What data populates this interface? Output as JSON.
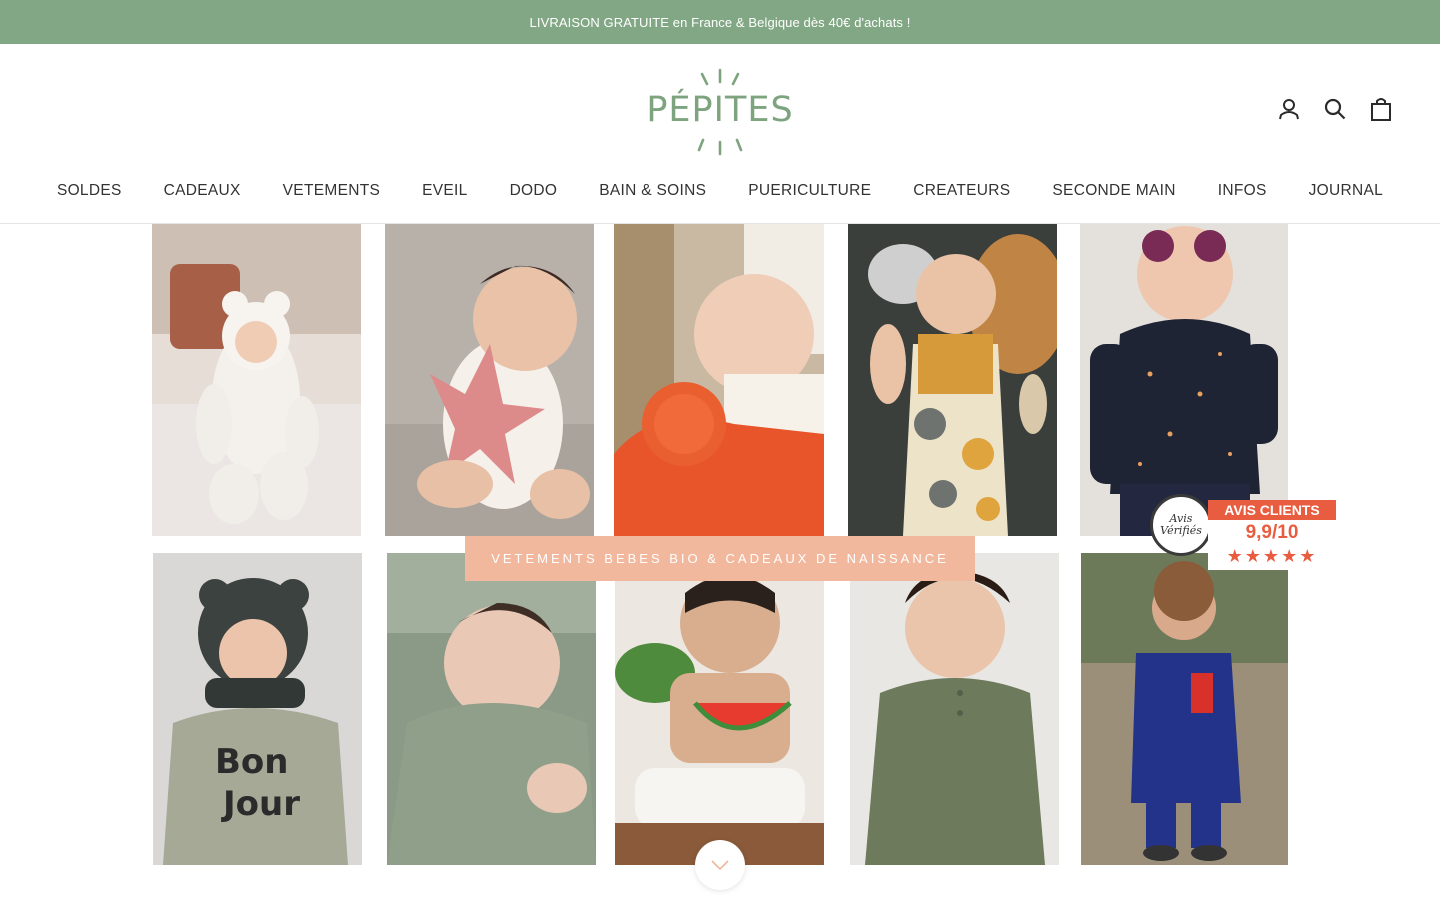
{
  "announcement": {
    "text": "LIVRAISON GRATUITE en France & Belgique dès 40€ d'achats !"
  },
  "logo": {
    "text": "PÉPITES",
    "color": "#7ea47f"
  },
  "nav": {
    "items": [
      "SOLDES",
      "CADEAUX",
      "VETEMENTS",
      "EVEIL",
      "DODO",
      "BAIN & SOINS",
      "PUERICULTURE",
      "CREATEURS",
      "SECONDE MAIN",
      "INFOS",
      "JOURNAL"
    ]
  },
  "header_icons": [
    "account-icon",
    "search-icon",
    "cart-icon"
  ],
  "hero": {
    "cta": "VETEMENTS BEBES BIO & CADEAUX DE NAISSANCE",
    "tiles": [
      "baby-white-teddy-suit",
      "baby-pink-starfish-toy",
      "baby-orange-lion-doudou",
      "baby-jungle-dungarees",
      "toddler-star-sweater",
      "baby-bear-hood-bonjour",
      "newborn-knit-sage",
      "baby-watermelon-toy",
      "baby-khaki-jumpsuit",
      "toddler-blue-overall"
    ]
  },
  "badge": {
    "seal": [
      "Avis",
      "Vérifiés"
    ],
    "title": "AVIS CLIENTS",
    "score": "9,9/10",
    "stars": "★★★★★"
  },
  "colors": {
    "accent": "#81a784",
    "cta": "#f2b89d",
    "badge": "#e85c3f"
  }
}
